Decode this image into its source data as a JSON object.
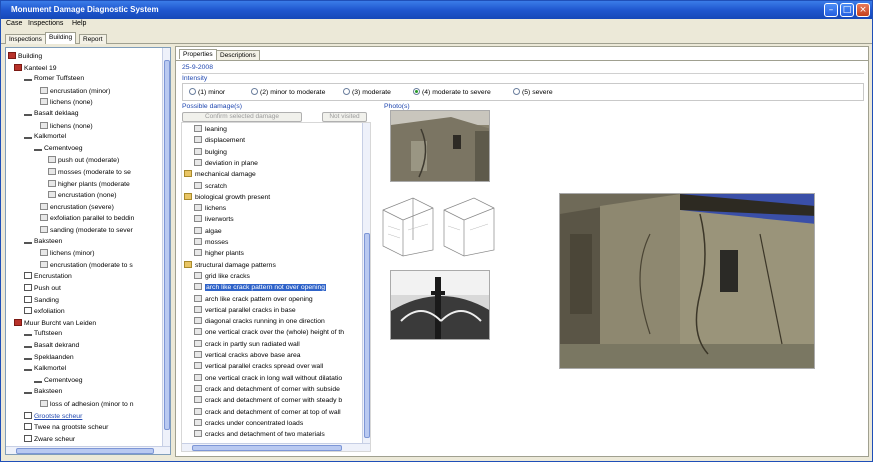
{
  "window": {
    "title": "Monument Damage Diagnostic System"
  },
  "menu": [
    "Case",
    "Inspections",
    "Help"
  ],
  "main_tabs": [
    "Inspections",
    "Building",
    "Report"
  ],
  "tree": [
    {
      "label": "Building",
      "icon": "building-icon"
    },
    {
      "label": "Kanteel 19",
      "icon": "building-part-icon"
    },
    {
      "label": "Romer Tuffsteen",
      "icon": "material-icon"
    },
    {
      "label": "encrustation (minor)",
      "icon": "damage-icon"
    },
    {
      "label": "lichens (none)",
      "icon": "damage-icon"
    },
    {
      "label": "Basalt deklaag",
      "icon": "material-icon"
    },
    {
      "label": "lichens (none)",
      "icon": "damage-icon"
    },
    {
      "label": "Kalkmortel",
      "icon": "material-icon"
    },
    {
      "label": "Cementvoeg",
      "icon": "material-icon"
    },
    {
      "label": "push out (moderate)",
      "icon": "damage-icon"
    },
    {
      "label": "mosses (moderate to se",
      "icon": "damage-icon"
    },
    {
      "label": "higher plants (moderate",
      "icon": "damage-icon"
    },
    {
      "label": "encrustation (none)",
      "icon": "damage-icon"
    },
    {
      "label": "encrustation (severe)",
      "icon": "damage-icon"
    },
    {
      "label": "exfoliation parallel to beddin",
      "icon": "damage-icon"
    },
    {
      "label": "sanding (moderate to sever",
      "icon": "damage-icon"
    },
    {
      "label": "Baksteen",
      "icon": "material-icon"
    },
    {
      "label": "lichens (minor)",
      "icon": "damage-icon"
    },
    {
      "label": "encrustation (moderate to s",
      "icon": "damage-icon"
    },
    {
      "label": "Encrustation",
      "icon": "checkbox-icon"
    },
    {
      "label": "Push out",
      "icon": "checkbox-icon"
    },
    {
      "label": "Sanding",
      "icon": "checkbox-icon"
    },
    {
      "label": "exfoliation",
      "icon": "checkbox-icon"
    },
    {
      "label": "Muur Burcht van Leiden",
      "icon": "building-part-icon"
    },
    {
      "label": "Tuftsteen",
      "icon": "material-icon"
    },
    {
      "label": "Basalt dekrand",
      "icon": "material-icon"
    },
    {
      "label": "Speklaanden",
      "icon": "material-icon"
    },
    {
      "label": "Kalkmortel",
      "icon": "material-icon"
    },
    {
      "label": "Cementvoeg",
      "icon": "material-icon"
    },
    {
      "label": "Baksteen",
      "icon": "material-icon"
    },
    {
      "label": "loss of adhesion (minor to n",
      "icon": "damage-icon"
    },
    {
      "label": "Grootste scheur",
      "icon": "checkbox-icon"
    },
    {
      "label": "Twee na grootste scheur",
      "icon": "checkbox-icon"
    },
    {
      "label": "Zware scheur",
      "icon": "checkbox-icon"
    }
  ],
  "sub_tabs": [
    "Properties",
    "Descriptions"
  ],
  "date": "25-9-2008",
  "intensity": {
    "label": "Intensity",
    "options": [
      "(1) minor",
      "(2) minor to moderate",
      "(3) moderate",
      "(4) moderate to severe",
      "(5) severe"
    ],
    "selected": "(4) moderate to severe"
  },
  "possible_damages": {
    "label": "Possible damage(s)",
    "confirm_button": "Confirm selected damage",
    "not_visited_button": "Not visited",
    "items": [
      {
        "label": "leaning",
        "type": "item"
      },
      {
        "label": "displacement",
        "type": "item"
      },
      {
        "label": "bulging",
        "type": "item"
      },
      {
        "label": "deviation in plane",
        "type": "item"
      },
      {
        "label": "mechanical damage",
        "type": "group"
      },
      {
        "label": "scratch",
        "type": "item"
      },
      {
        "label": "biological growth present",
        "type": "group"
      },
      {
        "label": "lichens",
        "type": "item"
      },
      {
        "label": "liverworts",
        "type": "item"
      },
      {
        "label": "algae",
        "type": "item"
      },
      {
        "label": "mosses",
        "type": "item"
      },
      {
        "label": "higher plants",
        "type": "item"
      },
      {
        "label": "structural damage patterns",
        "type": "group"
      },
      {
        "label": "grid like cracks",
        "type": "item"
      },
      {
        "label": "arch like crack pattern not over opening",
        "type": "item",
        "selected": true
      },
      {
        "label": "arch like crack pattern over opening",
        "type": "item"
      },
      {
        "label": "vertical parallel cracks in base",
        "type": "item"
      },
      {
        "label": "diagonal cracks running in one direction",
        "type": "item"
      },
      {
        "label": "one vertical crack over the (whole) height of th",
        "type": "item"
      },
      {
        "label": "crack in partly sun radiated wall",
        "type": "item"
      },
      {
        "label": "vertical cracks above base area",
        "type": "item"
      },
      {
        "label": "vertical parallel cracks spread over wall",
        "type": "item"
      },
      {
        "label": "one vertical crack in long wall without dilatatio",
        "type": "item"
      },
      {
        "label": "crack and detachment of corner with subside",
        "type": "item"
      },
      {
        "label": "crack and detachment of corner with steady b",
        "type": "item"
      },
      {
        "label": "crack and detachment of corner at top of wall",
        "type": "item"
      },
      {
        "label": "cracks under concentrated loads",
        "type": "item"
      },
      {
        "label": "cracks and detachment of two materials",
        "type": "item"
      }
    ]
  },
  "photos": {
    "label": "Photo(s)"
  },
  "colors": {
    "titlebar": "#1f57cf",
    "selection": "#2f63c9",
    "label_blue": "#1f47b0"
  }
}
